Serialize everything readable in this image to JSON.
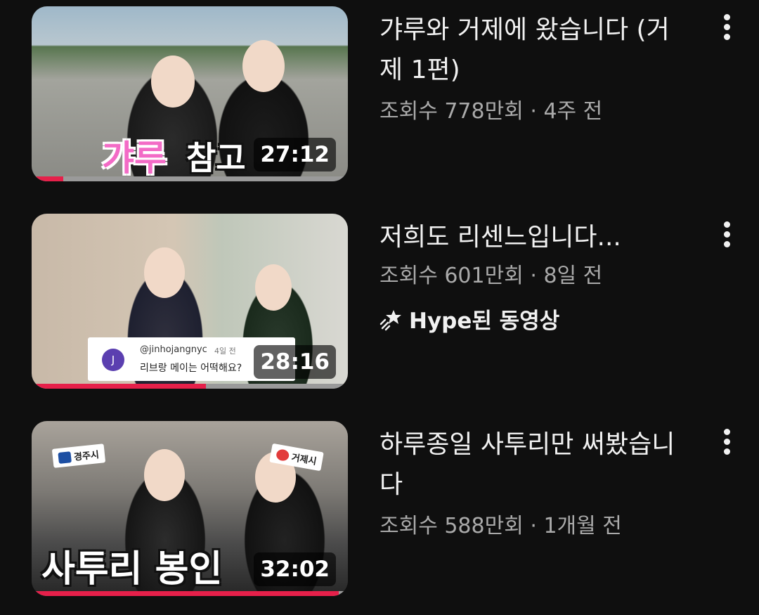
{
  "videos": [
    {
      "title": "갸루와 거제에 왔습니다 (거제 1편)",
      "views": "조회수 778만회",
      "sep": "·",
      "age": "4주 전",
      "duration": "27:12",
      "progress": 0.1,
      "thumb_text_a": "갸루",
      "thumb_text_b": "참고"
    },
    {
      "title": "저희도 리센느입니다...",
      "views": "조회수 601만회",
      "sep": "·",
      "age": "8일 전",
      "duration": "28:16",
      "progress": 0.55,
      "badge": "Hype된 동영상",
      "badge_icon": "hype-icon",
      "comment": {
        "avatar_letter": "J",
        "user": "@jinhojangnyc",
        "age": "4일 전",
        "text": "리브랑 메이는 어떡해요?"
      }
    },
    {
      "title": "하루종일 사투리만 써봤습니다",
      "views": "조회수 588만회",
      "sep": "·",
      "age": "1개월 전",
      "duration": "32:02",
      "progress": 0.97,
      "thumb_text_a": "사투리 봉인",
      "tag_left": "경주시",
      "tag_right": "거제시"
    }
  ],
  "colors": {
    "background": "#0f0f0f",
    "progress_watched": "#e6204a",
    "progress_track": "#9a9a9a",
    "meta_text": "#aaaaaa"
  }
}
